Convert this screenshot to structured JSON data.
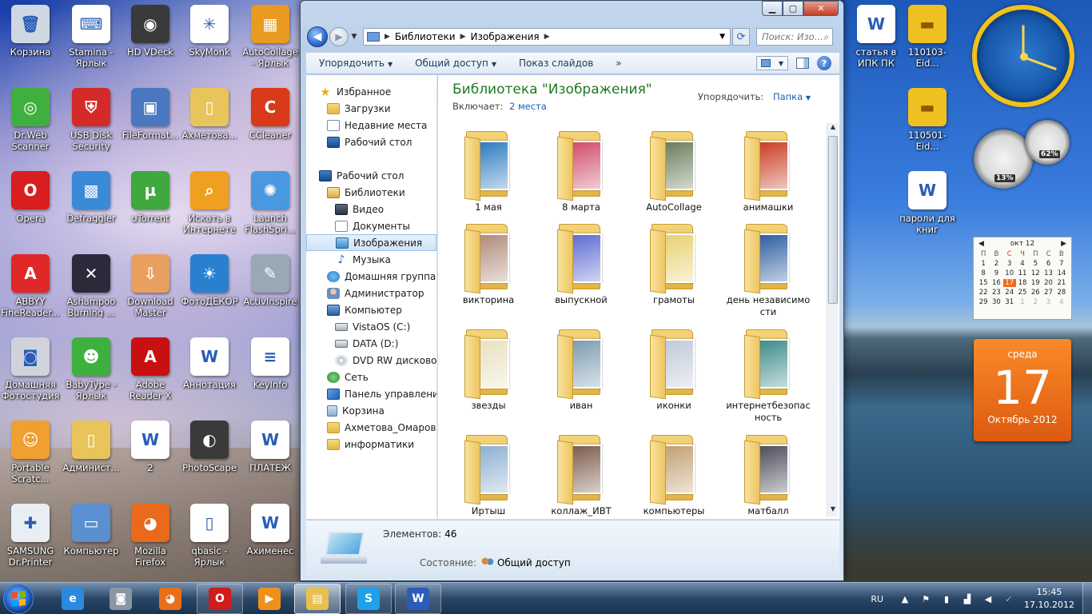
{
  "desktop": {
    "icons_left": [
      {
        "id": "recycle-bin",
        "label": "Корзина",
        "color": "#cfd8e2",
        "glyph": "🗑"
      },
      {
        "id": "stamina",
        "label": "Stamina - Ярлык",
        "color": "#ffffff",
        "glyph": "⌨"
      },
      {
        "id": "hd-vdeck",
        "label": "HD VDeck",
        "color": "#3a3a3a",
        "glyph": "◉"
      },
      {
        "id": "skymonk",
        "label": "SkyMonk",
        "color": "#ffffff",
        "glyph": "✳"
      },
      {
        "id": "autocollage",
        "label": "AutoCollage - Ярлык",
        "color": "#e89b20",
        "glyph": "▦"
      },
      {
        "id": "drweb",
        "label": "Dr.Web Scanner",
        "color": "#3fb03f",
        "glyph": "◎"
      },
      {
        "id": "usb-disk-security",
        "label": "USB Disk Security",
        "color": "#d42a2a",
        "glyph": "⛨"
      },
      {
        "id": "fileformat",
        "label": "FileFormat...",
        "color": "#4a78c0",
        "glyph": "▣"
      },
      {
        "id": "akhmetova",
        "label": "Ахметова...",
        "color": "#e8c45a",
        "glyph": "▯"
      },
      {
        "id": "ccleaner",
        "label": "CCleaner",
        "color": "#d83a1a",
        "glyph": "C"
      },
      {
        "id": "opera",
        "label": "Opera",
        "color": "#d81e1e",
        "glyph": "O"
      },
      {
        "id": "defraggler",
        "label": "Defraggler",
        "color": "#3a8ad8",
        "glyph": "▩"
      },
      {
        "id": "utorrent",
        "label": "uTorrent",
        "color": "#3fa83f",
        "glyph": "µ"
      },
      {
        "id": "search-internet",
        "label": "Искать в Интернете",
        "color": "#f0a020",
        "glyph": "⌕"
      },
      {
        "id": "launch-flashspr",
        "label": "Launch FlashSpri...",
        "color": "#4a98e0",
        "glyph": "✺"
      },
      {
        "id": "abbyy",
        "label": "ABBYY FineReader...",
        "color": "#e02828",
        "glyph": "A"
      },
      {
        "id": "ashampoo",
        "label": "Ashampoo Burning ...",
        "color": "#2a2a3a",
        "glyph": "✕"
      },
      {
        "id": "download-master",
        "label": "Download Master",
        "color": "#e8a060",
        "glyph": "⇩"
      },
      {
        "id": "fotodekor",
        "label": "ФотоДЕКОР",
        "color": "#2a80d0",
        "glyph": "☀"
      },
      {
        "id": "activinspire",
        "label": "ActivInspire",
        "color": "#9aa8b5",
        "glyph": "✎"
      },
      {
        "id": "home-photostudio",
        "label": "Домашняя Фотостудия",
        "color": "#d0d4da",
        "glyph": "◙"
      },
      {
        "id": "babytype",
        "label": "BabyType - Ярлык",
        "color": "#3eb03e",
        "glyph": "☻"
      },
      {
        "id": "adobe-reader",
        "label": "Adobe Reader X",
        "color": "#c81010",
        "glyph": "A"
      },
      {
        "id": "annotation",
        "label": "Аннотация",
        "color": "#ffffff",
        "glyph": "W"
      },
      {
        "id": "keyinfo",
        "label": "KeyInfo",
        "color": "#ffffff",
        "glyph": "≡"
      },
      {
        "id": "portable-scratch",
        "label": "Portable Scratc...",
        "color": "#f0a030",
        "glyph": "☺"
      },
      {
        "id": "administrator",
        "label": "Админист...",
        "color": "#e8c45a",
        "glyph": "▯"
      },
      {
        "id": "doc-2",
        "label": "2",
        "color": "#ffffff",
        "glyph": "W"
      },
      {
        "id": "photoscape",
        "label": "PhotoScape",
        "color": "#3a3a3a",
        "glyph": "◐"
      },
      {
        "id": "platezh",
        "label": "ПЛАТЕЖ",
        "color": "#ffffff",
        "glyph": "W"
      },
      {
        "id": "samsung-printer",
        "label": "SAMSUNG Dr.Printer",
        "color": "#e8eef4",
        "glyph": "✚"
      },
      {
        "id": "computer",
        "label": "Компьютер",
        "color": "#5a90d0",
        "glyph": "▭"
      },
      {
        "id": "firefox",
        "label": "Mozilla Firefox",
        "color": "#e86a1a",
        "glyph": "◕"
      },
      {
        "id": "qbasic",
        "label": "qbasic - Ярлык",
        "color": "#ffffff",
        "glyph": "▯"
      },
      {
        "id": "akhmenes",
        "label": "Ахименес",
        "color": "#ffffff",
        "glyph": "W"
      }
    ],
    "icons_right": [
      {
        "id": "statya",
        "label": "статья в ИПК ПК",
        "color": "#ffffff",
        "glyph": "W"
      },
      {
        "id": "book-110103",
        "label": "110103-Eid...",
        "color": "#f0c020",
        "glyph": "▬"
      },
      {
        "id": "book-110501",
        "label": "110501-Eid...",
        "color": "#f0c020",
        "glyph": "▬"
      },
      {
        "id": "paroli",
        "label": "пароли для книг",
        "color": "#ffffff",
        "glyph": "W"
      }
    ]
  },
  "window": {
    "min_label": "▁",
    "max_label": "▢",
    "close_label": "✕",
    "breadcrumb": [
      "Библиотеки",
      "Изображения"
    ],
    "search_placeholder": "Поиск: Изо...",
    "commands": {
      "organize": "Упорядочить",
      "share": "Общий доступ",
      "slideshow": "Показ слайдов",
      "more": "»"
    },
    "nav": [
      {
        "label": "Избранное",
        "icon": "star",
        "indent": 0
      },
      {
        "label": "Загрузки",
        "icon": "folder",
        "indent": 1
      },
      {
        "label": "Недавние места",
        "icon": "doc",
        "indent": 1
      },
      {
        "label": "Рабочий стол",
        "icon": "monitor",
        "indent": 1
      },
      {
        "label": "",
        "icon": "",
        "indent": 0,
        "spacer": true
      },
      {
        "label": "Рабочий стол",
        "icon": "monitor",
        "indent": 0
      },
      {
        "label": "Библиотеки",
        "icon": "lib",
        "indent": 1
      },
      {
        "label": "Видео",
        "icon": "video",
        "indent": 2
      },
      {
        "label": "Документы",
        "icon": "doc",
        "indent": 2
      },
      {
        "label": "Изображения",
        "icon": "img",
        "indent": 2,
        "selected": true
      },
      {
        "label": "Музыка",
        "icon": "music",
        "indent": 2
      },
      {
        "label": "Домашняя группа",
        "icon": "homegroup",
        "indent": 1
      },
      {
        "label": "Администратор",
        "icon": "user",
        "indent": 1
      },
      {
        "label": "Компьютер",
        "icon": "computer",
        "indent": 1
      },
      {
        "label": "VistaOS (C:)",
        "icon": "drive",
        "indent": 2
      },
      {
        "label": "DATA (D:)",
        "icon": "drive",
        "indent": 2
      },
      {
        "label": "DVD RW дисковод",
        "icon": "dvd",
        "indent": 2
      },
      {
        "label": "Сеть",
        "icon": "network",
        "indent": 1
      },
      {
        "label": "Панель управления",
        "icon": "cpanel",
        "indent": 1
      },
      {
        "label": "Корзина",
        "icon": "bin",
        "indent": 1
      },
      {
        "label": "Ахметова_Омаров",
        "icon": "folder",
        "indent": 1
      },
      {
        "label": "информатики",
        "icon": "folder",
        "indent": 1
      }
    ],
    "library_title": "Библиотека \"Изображения\"",
    "includes_label": "Включает:",
    "includes_link": "2 места",
    "arrange_label": "Упорядочить:",
    "arrange_value": "Папка",
    "folders": [
      {
        "name": "1 мая",
        "tint": "#2a7ac0"
      },
      {
        "name": "8 марта",
        "tint": "#d04a6a"
      },
      {
        "name": "AutoCollage",
        "tint": "#6a7a5a"
      },
      {
        "name": "анимашки",
        "tint": "#c83a20"
      },
      {
        "name": "викторина",
        "tint": "#b08a7a"
      },
      {
        "name": "выпускной",
        "tint": "#5a6ad0"
      },
      {
        "name": "грамоты",
        "tint": "#e8d070"
      },
      {
        "name": "день независимости",
        "tint": "#2a5aa0"
      },
      {
        "name": "звезды",
        "tint": "#e8e0c0"
      },
      {
        "name": "иван",
        "tint": "#7a9ab0"
      },
      {
        "name": "иконки",
        "tint": "#c0c8d8"
      },
      {
        "name": "интернетбезопасность",
        "tint": "#3a8a8a"
      },
      {
        "name": "Иртыш",
        "tint": "#8ab0d0"
      },
      {
        "name": "коллаж_ИВТ",
        "tint": "#7a5a4a"
      },
      {
        "name": "компьютеры",
        "tint": "#c0a070"
      },
      {
        "name": "матбалл",
        "tint": "#4a4a5a"
      }
    ],
    "details": {
      "count_label": "Элементов:",
      "count_value": "46",
      "status_label": "Состояние:",
      "status_value": "Общий доступ"
    }
  },
  "gadgets": {
    "cpu_percent": "13%",
    "ram_percent": "62%",
    "calendar_month": "окт 12",
    "weekdays": [
      "П",
      "В",
      "С",
      "Ч",
      "П",
      "С",
      "В"
    ],
    "calendar_days": [
      [
        "1",
        "2",
        "3",
        "4",
        "5",
        "6",
        "7"
      ],
      [
        "8",
        "9",
        "10",
        "11",
        "12",
        "13",
        "14"
      ],
      [
        "15",
        "16",
        "17",
        "18",
        "19",
        "20",
        "21"
      ],
      [
        "22",
        "23",
        "24",
        "25",
        "26",
        "27",
        "28"
      ],
      [
        "29",
        "30",
        "31",
        "1",
        "2",
        "3",
        "4"
      ]
    ],
    "today": "17",
    "day_of_week": "среда",
    "big_day": "17",
    "month_year": "Октябрь 2012"
  },
  "taskbar": {
    "apps": [
      {
        "id": "ie",
        "color": "#2a8ae0",
        "glyph": "e",
        "state": "none"
      },
      {
        "id": "camera",
        "color": "#8a96a4",
        "glyph": "◙",
        "state": "none"
      },
      {
        "id": "firefox",
        "color": "#e8701a",
        "glyph": "◕",
        "state": "none"
      },
      {
        "id": "opera-mail",
        "color": "#d01c1c",
        "glyph": "O",
        "state": "open"
      },
      {
        "id": "media-player",
        "color": "#f0901a",
        "glyph": "▶",
        "state": "none"
      },
      {
        "id": "explorer",
        "color": "#e8c050",
        "glyph": "▤",
        "state": "active"
      },
      {
        "id": "skype",
        "color": "#20a0e8",
        "glyph": "S",
        "state": "open"
      },
      {
        "id": "word",
        "color": "#2a5cb8",
        "glyph": "W",
        "state": "open"
      }
    ],
    "lang": "RU",
    "time": "15:45",
    "date": "17.10.2012"
  }
}
